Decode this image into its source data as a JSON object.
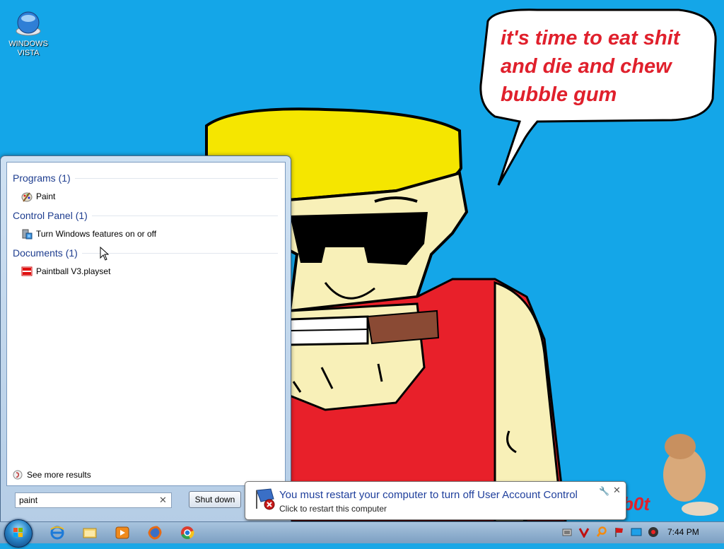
{
  "desktop": {
    "icon_label": "WINDOWS VISTA",
    "speech_bubble": "it's time to eat shit and die and chew bubble gum",
    "partial_text": "b0t"
  },
  "start_menu": {
    "groups": [
      {
        "title": "Programs (1)",
        "items": [
          {
            "label": "Paint",
            "icon": "paint-icon"
          }
        ]
      },
      {
        "title": "Control Panel (1)",
        "items": [
          {
            "label": "Turn Windows features on or off",
            "icon": "windows-features-icon"
          }
        ]
      },
      {
        "title": "Documents (1)",
        "items": [
          {
            "label": "Paintball V3.playset",
            "icon": "playset-file-icon"
          }
        ]
      }
    ],
    "see_more": "See more results",
    "search_value": "paint",
    "shutdown_label": "Shut down"
  },
  "notification": {
    "title": "You must restart your computer to turn off User Account Control",
    "subtitle": "Click to restart this computer"
  },
  "taskbar": {
    "pinned": [
      "internet-explorer-icon",
      "windows-explorer-icon",
      "media-player-icon",
      "firefox-icon",
      "chrome-icon"
    ],
    "tray": [
      "network-icon",
      "antivirus-icon",
      "search-tray-icon",
      "flag-icon",
      "display-icon",
      "record-icon"
    ],
    "clock": "7:44 PM"
  }
}
